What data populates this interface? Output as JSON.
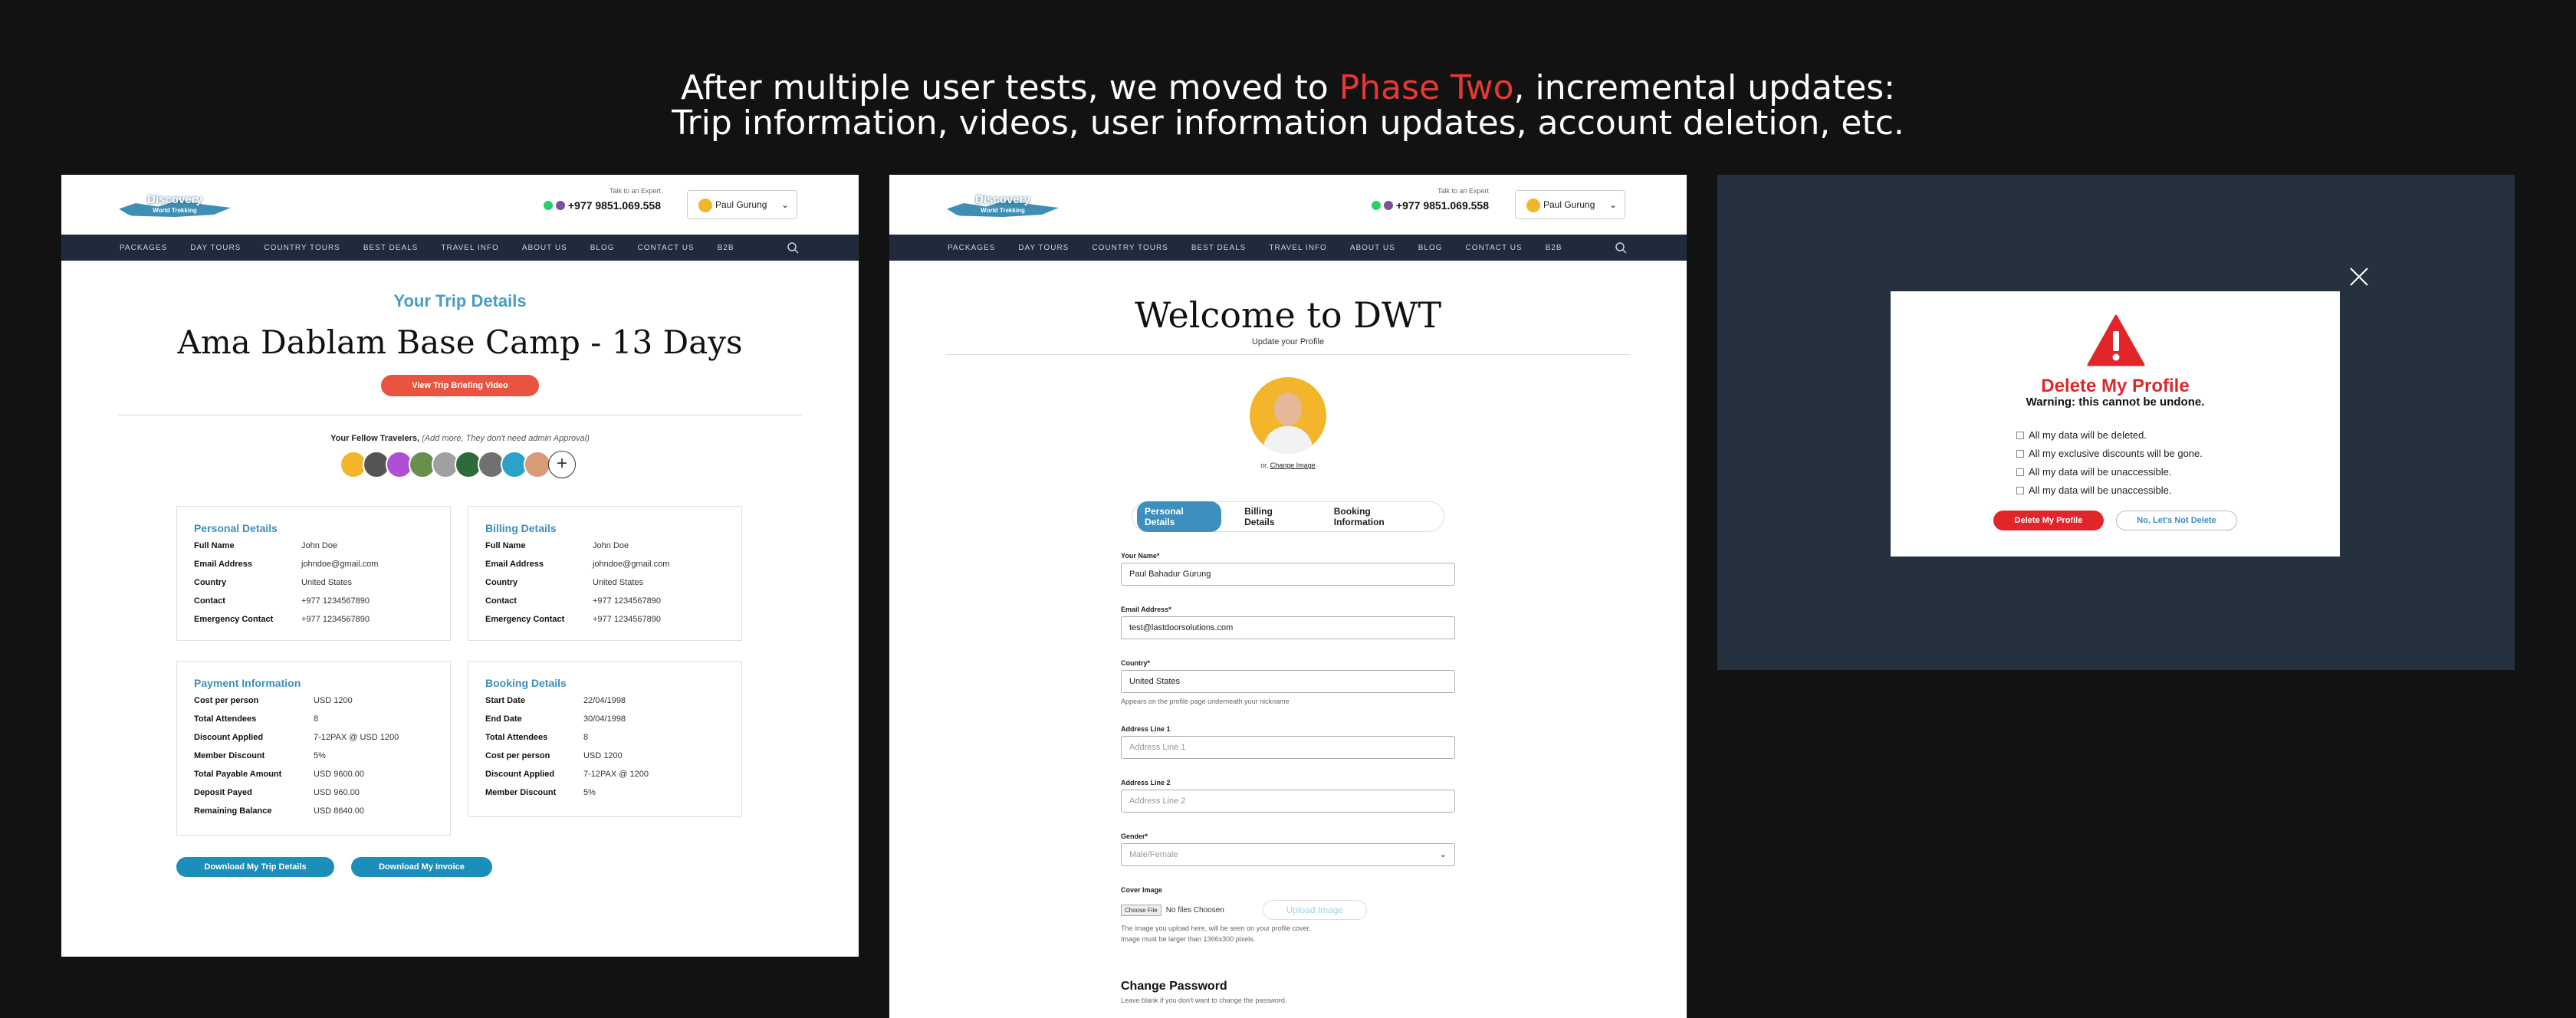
{
  "headline": {
    "line1_pre": "After multiple user tests, we moved to ",
    "line1_highlight": "Phase Two",
    "line1_post": ", incremental updates:",
    "line2": "Trip information, videos, user information updates, account deletion, etc."
  },
  "site": {
    "logo_text": "Discovery",
    "logo_sub": "World Trekking",
    "expert_label": "Talk to an Expert",
    "phone": "+977 9851.069.558",
    "user_name": "Paul Gurung",
    "nav": [
      "PACKAGES",
      "DAY TOURS",
      "COUNTRY TOURS",
      "BEST DEALS",
      "TRAVEL INFO",
      "ABOUT US",
      "BLOG",
      "CONTACT US",
      "B2B"
    ]
  },
  "trip": {
    "section_title": "Your Trip Details",
    "trip_name": "Ama Dablam Base Camp - 13 Days",
    "video_button": "View Trip Briefing Video",
    "fellow_label": "Your Fellow Travelers,",
    "fellow_note": "(Add more, They don't need admin Approval)",
    "avatar_colors": [
      "#f3b52c",
      "#555555",
      "#b04ed6",
      "#6a8f4c",
      "#a0a0a0",
      "#2e6b3a",
      "#707070",
      "#2ba3c9",
      "#d99a78"
    ],
    "personal": {
      "title": "Personal Details",
      "rows": [
        {
          "k": "Full Name",
          "v": "John Doe"
        },
        {
          "k": "Email Address",
          "v": "johndoe@gmail.com"
        },
        {
          "k": "Country",
          "v": "United States"
        },
        {
          "k": "Contact",
          "v": "+977 1234567890"
        },
        {
          "k": "Emergency Contact",
          "v": "+977 1234567890"
        }
      ]
    },
    "billing": {
      "title": "Billing Details",
      "rows": [
        {
          "k": "Full Name",
          "v": "John Doe"
        },
        {
          "k": "Email Address",
          "v": "johndoe@gmail.com"
        },
        {
          "k": "Country",
          "v": "United States"
        },
        {
          "k": "Contact",
          "v": "+977 1234567890"
        },
        {
          "k": "Emergency Contact",
          "v": "+977 1234567890"
        }
      ]
    },
    "payment": {
      "title": "Payment Information",
      "rows": [
        {
          "k": "Cost per person",
          "v": "USD 1200"
        },
        {
          "k": "Total Attendees",
          "v": "8"
        },
        {
          "k": "Discount Applied",
          "v": "7-12PAX @ USD 1200"
        },
        {
          "k": "Member Discount",
          "v": "5%"
        },
        {
          "k": "Total  Payable Amount",
          "v": "USD 9600.00"
        },
        {
          "k": "Deposit Payed",
          "v": "USD 960.00"
        },
        {
          "k": "Remaining Balance",
          "v": "USD 8640.00"
        }
      ]
    },
    "booking": {
      "title": "Booking Details",
      "rows": [
        {
          "k": "Start Date",
          "v": "22/04/1998"
        },
        {
          "k": "End Date",
          "v": "30/04/1998"
        },
        {
          "k": "Total Attendees",
          "v": "8"
        },
        {
          "k": "Cost per person",
          "v": "USD 1200"
        },
        {
          "k": "Discount Applied",
          "v": "7-12PAX @ 1200"
        },
        {
          "k": "Member Discount",
          "v": "5%"
        }
      ]
    },
    "download_trip": "Download My Trip Details",
    "download_invoice": "Download My Invoice"
  },
  "profile": {
    "title": "Welcome to DWT",
    "subtitle": "Update your Profile",
    "change_prefix": "or,",
    "change_image": "Change Image",
    "tabs": [
      "Personal Details",
      "Billing Details",
      "Booking Information"
    ],
    "fields": {
      "name_label": "Your Name*",
      "name_value": "Paul Bahadur Gurung",
      "email_label": "Email Address*",
      "email_value": "test@lastdoorsolutions.com",
      "country_label": "Country*",
      "country_value": "United States",
      "country_help": "Appears on the profile page underneath your nickname",
      "addr1_label": "Address Line 1",
      "addr1_placeholder": "Address Line 1",
      "addr2_label": "Address Line 2",
      "addr2_placeholder": "Address Line 2",
      "gender_label": "Gender*",
      "gender_placeholder": "Male/Female",
      "cover_label": "Cover Image",
      "choose_file": "Choose File",
      "no_file": "No files Choosen",
      "upload": "Upload Image",
      "cover_help1": "The image you upload here, will be seen on your profile cover.",
      "cover_help2": "Image must be larger than 1366x300 pixels."
    },
    "change_password": "Change Password",
    "change_password_help": "Leave blank if you don't want to change the password."
  },
  "delete_modal": {
    "title": "Delete My Profile",
    "warning": "Warning: this cannot be undone.",
    "items": [
      "All my data will be deleted.",
      "All my exclusive discounts will be gone.",
      "All my data will be unaccessible.",
      "All my data will be unaccessible."
    ],
    "confirm": "Delete My Profile",
    "cancel": "No, Let's Not Delete"
  },
  "colors": {
    "accent_blue": "#3c8fbe",
    "nav_bg": "#1f2b3a",
    "danger": "#e0262b",
    "highlight": "#e53935"
  }
}
